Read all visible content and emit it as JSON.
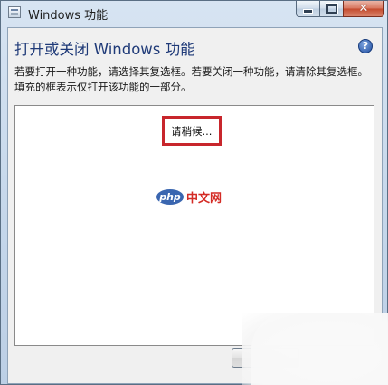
{
  "window": {
    "title": "Windows 功能",
    "caption_buttons": {
      "minimize_icon": "minimize-icon",
      "maximize_icon": "maximize-icon",
      "close_icon": "close-icon",
      "close_glyph": "✕"
    }
  },
  "dialog": {
    "heading": "打开或关闭 Windows 功能",
    "help_glyph": "?",
    "description": "若要打开一种功能，请选择其复选框。若要关闭一种功能，请清除其复选框。填充的框表示仅打开该功能的一部分。",
    "loading_text": "请稍候...",
    "highlight_color": "#c8262c"
  },
  "watermark": {
    "logo_text": "php",
    "site_text": "中文网"
  }
}
